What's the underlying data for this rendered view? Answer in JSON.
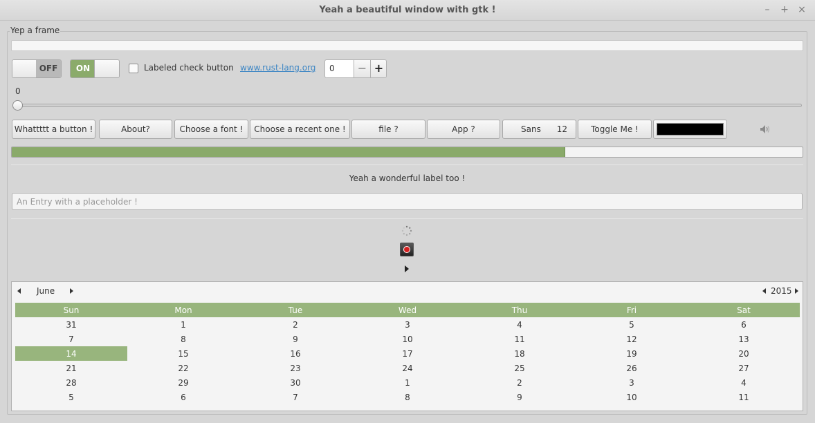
{
  "window": {
    "title": "Yeah a beautiful window with gtk !",
    "minimize": "–",
    "maximize": "+",
    "close": "×"
  },
  "frame": {
    "label": "Yep a frame"
  },
  "switches": [
    {
      "label": "OFF",
      "state": "off"
    },
    {
      "label": "ON",
      "state": "on"
    }
  ],
  "check_button": {
    "label": "Labeled check button",
    "checked": false
  },
  "link_button": {
    "label": "www.rust-lang.org"
  },
  "spin_button": {
    "value": "0",
    "minus": "−",
    "plus": "+"
  },
  "scale": {
    "value": "0",
    "fraction": 0
  },
  "buttons": {
    "button": "Whattttt a button !",
    "about": "About?",
    "font": "Choose a font !",
    "recent": "Choose a recent one !",
    "file": "file ?",
    "app": "App ?",
    "font_button_name": "Sans",
    "font_button_size": "12",
    "toggle": "Toggle Me !"
  },
  "color_button": {
    "color": "#000000"
  },
  "volume": {
    "icon": "speaker-icon"
  },
  "progress": {
    "fraction": 0.7
  },
  "label": {
    "text": "Yeah a wonderful label too !"
  },
  "entry": {
    "placeholder": "An Entry with a placeholder !",
    "value": ""
  },
  "calendar": {
    "month": "June",
    "year": "2015",
    "weekdays": [
      "Sun",
      "Mon",
      "Tue",
      "Wed",
      "Thu",
      "Fri",
      "Sat"
    ],
    "weeks": [
      [
        "31",
        "1",
        "2",
        "3",
        "4",
        "5",
        "6"
      ],
      [
        "7",
        "8",
        "9",
        "10",
        "11",
        "12",
        "13"
      ],
      [
        "14",
        "15",
        "16",
        "17",
        "18",
        "19",
        "20"
      ],
      [
        "21",
        "22",
        "23",
        "24",
        "25",
        "26",
        "27"
      ],
      [
        "28",
        "29",
        "30",
        "1",
        "2",
        "3",
        "4"
      ],
      [
        "5",
        "6",
        "7",
        "8",
        "9",
        "10",
        "11"
      ]
    ],
    "selected_day": "14",
    "accent": "#98b57d"
  }
}
